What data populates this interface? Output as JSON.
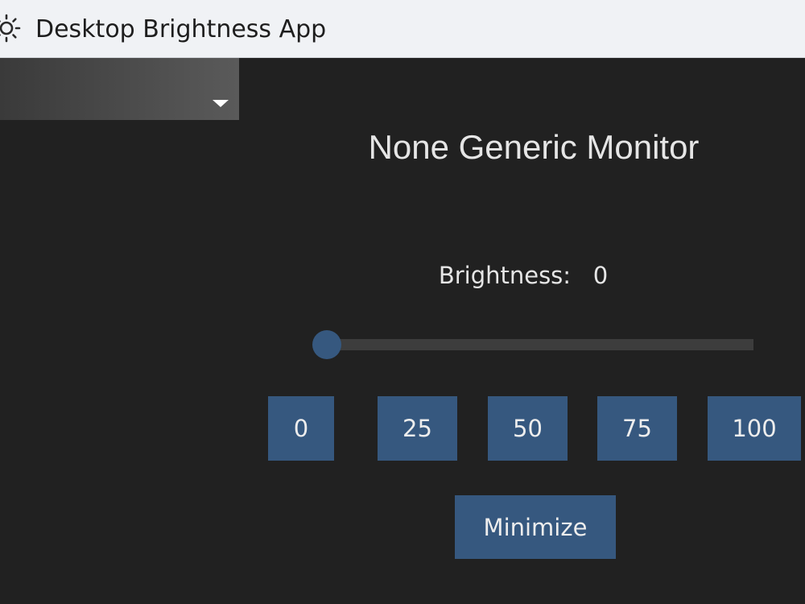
{
  "window": {
    "title": "Desktop Brightness App",
    "icon": "sun-icon"
  },
  "monitor_dropdown": {
    "selected": "",
    "icon": "chevron-down-icon"
  },
  "monitor": {
    "name": "None Generic Monitor"
  },
  "brightness": {
    "label": "Brightness:",
    "value": "0",
    "slider_value": 0,
    "slider_max": 100
  },
  "presets": [
    {
      "label": "0"
    },
    {
      "label": "25"
    },
    {
      "label": "50"
    },
    {
      "label": "75"
    },
    {
      "label": "100"
    }
  ],
  "minimize_label": "Minimize",
  "colors": {
    "accent": "#36587f",
    "background": "#212121",
    "titlebar": "#f0f2f5"
  }
}
